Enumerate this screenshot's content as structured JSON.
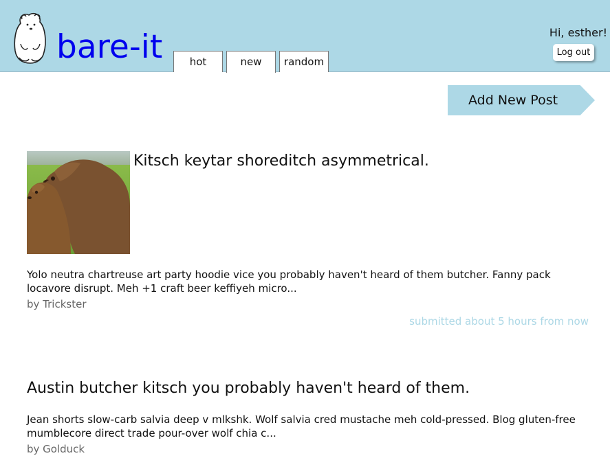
{
  "header": {
    "site_title": "bare-it",
    "greeting": "Hi, esther!",
    "logout_label": "Log out",
    "logo_icon": "polar-bear-icon",
    "tabs": [
      {
        "label": "hot"
      },
      {
        "label": "new",
        "active": true
      },
      {
        "label": "random"
      }
    ]
  },
  "actions": {
    "add_post_label": "Add New Post"
  },
  "posts": [
    {
      "title": "Kitsch keytar shoreditch asymmetrical.",
      "thumbnail": "bears-photo",
      "excerpt": "Yolo neutra chartreuse art party hoodie vice you probably haven't heard of them butcher. Fanny pack locavore disrupt. Meh +1 craft beer keffiyeh micro...",
      "author": "by Trickster",
      "submitted": "submitted about 5 hours from now"
    },
    {
      "title": "Austin butcher kitsch you probably haven't heard of them.",
      "excerpt": "Jean shorts slow-carb salvia deep v mlkshk. Wolf salvia cred mustache meh cold-pressed. Blog gluten-free mumblecore direct trade pour-over wolf chia c...",
      "author": "by Golduck"
    }
  ],
  "colors": {
    "header_bg": "#add8e6",
    "title_link": "#0000ee",
    "author_text": "#666666",
    "timestamp_text": "#add8e6"
  }
}
